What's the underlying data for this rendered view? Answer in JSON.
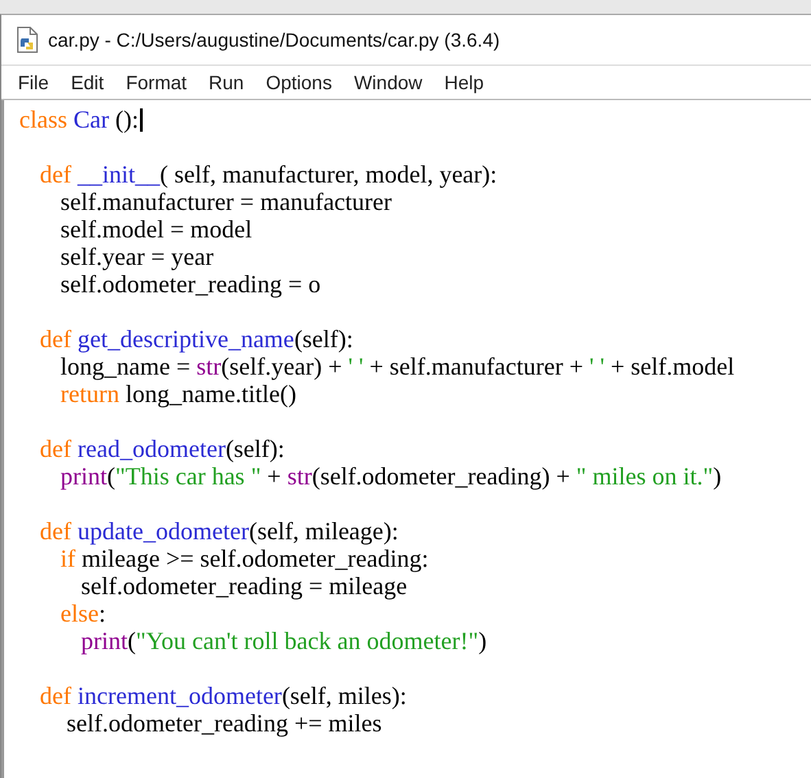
{
  "window": {
    "title": "car.py - C:/Users/augustine/Documents/car.py (3.6.4)"
  },
  "menu": [
    "File",
    "Edit",
    "Format",
    "Run",
    "Options",
    "Window",
    "Help"
  ],
  "editor": {
    "lines": [
      {
        "cursor": true,
        "tokens": [
          {
            "kind": "keyword",
            "text": "class"
          },
          {
            "kind": "name",
            "text": " Car"
          },
          {
            "kind": "plain",
            "text": " ():"
          }
        ],
        "children": [
          {
            "tokens": [
              {
                "kind": "keyword",
                "text": "def"
              },
              {
                "kind": "name",
                "text": " __init__"
              },
              {
                "kind": "plain",
                "text": "( self, manufacturer, model, year):"
              }
            ],
            "children": [
              {
                "tokens": [
                  {
                    "kind": "plain",
                    "text": "self.manufacturer = manufacturer"
                  }
                ]
              },
              {
                "tokens": [
                  {
                    "kind": "plain",
                    "text": "self.model = model"
                  }
                ]
              },
              {
                "tokens": [
                  {
                    "kind": "plain",
                    "text": "self.year = year"
                  }
                ]
              },
              {
                "tokens": [
                  {
                    "kind": "plain",
                    "text": "self.odometer_reading = o"
                  }
                ]
              }
            ]
          },
          {
            "tokens": [
              {
                "kind": "keyword",
                "text": "def"
              },
              {
                "kind": "name",
                "text": " get_descriptive_name"
              },
              {
                "kind": "plain",
                "text": "(self):"
              }
            ],
            "children": [
              {
                "tokens": [
                  {
                    "kind": "plain",
                    "text": "long_name = "
                  },
                  {
                    "kind": "builtin",
                    "text": "str"
                  },
                  {
                    "kind": "plain",
                    "text": "(self.year) + "
                  },
                  {
                    "kind": "string",
                    "text": "' '"
                  },
                  {
                    "kind": "plain",
                    "text": " + self.manufacturer + "
                  },
                  {
                    "kind": "string",
                    "text": "' '"
                  },
                  {
                    "kind": "plain",
                    "text": " + self.model"
                  }
                ]
              },
              {
                "tokens": [
                  {
                    "kind": "keyword",
                    "text": "return"
                  },
                  {
                    "kind": "plain",
                    "text": " long_name.title()"
                  }
                ]
              }
            ]
          },
          {
            "tokens": [
              {
                "kind": "keyword",
                "text": "def"
              },
              {
                "kind": "name",
                "text": " read_odometer"
              },
              {
                "kind": "plain",
                "text": "(self):"
              }
            ],
            "children": [
              {
                "tokens": [
                  {
                    "kind": "builtin",
                    "text": "print"
                  },
                  {
                    "kind": "plain",
                    "text": "("
                  },
                  {
                    "kind": "string",
                    "text": "\"This car has \""
                  },
                  {
                    "kind": "plain",
                    "text": " + "
                  },
                  {
                    "kind": "builtin",
                    "text": "str"
                  },
                  {
                    "kind": "plain",
                    "text": "(self.odometer_reading) + "
                  },
                  {
                    "kind": "string",
                    "text": "\" miles on it.\""
                  },
                  {
                    "kind": "plain",
                    "text": ")"
                  }
                ]
              }
            ]
          },
          {
            "tokens": [
              {
                "kind": "keyword",
                "text": "def"
              },
              {
                "kind": "name",
                "text": " update_odometer"
              },
              {
                "kind": "plain",
                "text": "(self, mileage):"
              }
            ],
            "children": [
              {
                "tokens": [
                  {
                    "kind": "keyword",
                    "text": "if"
                  },
                  {
                    "kind": "plain",
                    "text": " mileage >= self.odometer_reading:"
                  }
                ],
                "children": [
                  {
                    "tokens": [
                      {
                        "kind": "plain",
                        "text": "self.odometer_reading = mileage"
                      }
                    ]
                  }
                ]
              },
              {
                "tokens": [
                  {
                    "kind": "keyword",
                    "text": "else"
                  },
                  {
                    "kind": "plain",
                    "text": ":"
                  }
                ],
                "children": [
                  {
                    "tokens": [
                      {
                        "kind": "builtin",
                        "text": "print"
                      },
                      {
                        "kind": "plain",
                        "text": "("
                      },
                      {
                        "kind": "string",
                        "text": "\"You can't roll back an odometer!\""
                      },
                      {
                        "kind": "plain",
                        "text": ")"
                      }
                    ]
                  }
                ]
              }
            ]
          },
          {
            "tokens": [
              {
                "kind": "keyword",
                "text": "def"
              },
              {
                "kind": "name",
                "text": " increment_odometer"
              },
              {
                "kind": "plain",
                "text": "(self, miles):"
              }
            ],
            "children": [
              {
                "tokens": [
                  {
                    "kind": "plain",
                    "text": " self.odometer_reading += miles"
                  }
                ]
              }
            ]
          }
        ]
      }
    ]
  }
}
